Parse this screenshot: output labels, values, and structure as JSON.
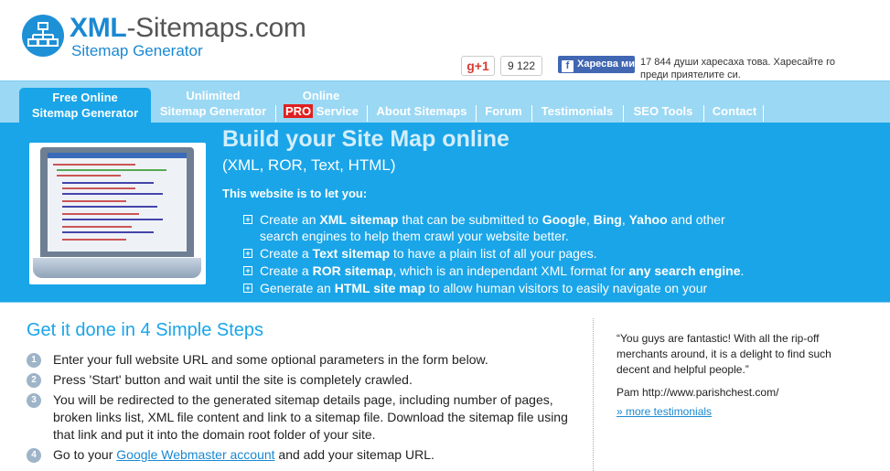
{
  "header": {
    "logo_xml": "XML",
    "logo_rest": "-Sitemaps.com",
    "logo_sub": "Sitemap Generator",
    "gplus_label": "g+1",
    "gplus_count": "9 122",
    "fb_label": "Харесва ми",
    "fb_text": "17 844 души харесаха това. Харесайте го преди приятелите си."
  },
  "nav": {
    "active_line1": "Free Online",
    "active_line2": "Sitemap Generator",
    "unlimited_line1": "Unlimited",
    "unlimited_line2": "Sitemap Generator",
    "online_line1": "Online",
    "pro": "PRO",
    "service": " Service",
    "about": "About Sitemaps",
    "forum": "Forum",
    "testimonials": "Testimonials",
    "seo": "SEO Tools",
    "contact": "Contact"
  },
  "hero": {
    "title": "Build your Site Map online",
    "subtitle": "(XML, ROR, Text, HTML)",
    "lead": "This website is to let you:",
    "items": [
      {
        "a": "Create an ",
        "b": "XML sitemap",
        "c": " that can be submitted to ",
        "d": "Google",
        "e": ", ",
        "f": "Bing",
        "g": ", ",
        "h": "Yahoo",
        "i": " and other search engines to help them crawl your website better."
      },
      {
        "a": "Create a ",
        "b": "Text sitemap",
        "c": " to have a plain list of all your pages."
      },
      {
        "a": "Create a ",
        "b": "ROR sitemap",
        "c": ", which is an independant XML format for ",
        "d": "any search engine",
        "e": "."
      },
      {
        "a": "Generate an ",
        "b": "HTML site map",
        "c": " to allow human visitors to easily navigate on your"
      }
    ]
  },
  "steps": {
    "title": "Get it done in 4 Simple Steps",
    "items": [
      {
        "num": "1",
        "text": "Enter your full website URL and some optional parameters in the form below."
      },
      {
        "num": "2",
        "text": "Press 'Start' button and wait until the site is completely crawled."
      },
      {
        "num": "3",
        "text": "You will be redirected to the generated sitemap details page, including number of pages, broken links list, XML file content and link to a sitemap file. Download the sitemap file using that link and put it into the domain root folder of your site."
      },
      {
        "num": "4",
        "pre": "Go to your ",
        "link": "Google Webmaster account",
        "post": " and add your sitemap URL."
      }
    ]
  },
  "testimonial": {
    "quote": "“You guys are fantastic! With all the rip-off merchants around, it is a delight to find such decent and helpful people.”",
    "author": "Pam http://www.parishchest.com/",
    "more": "» more testimonials"
  },
  "colors": {
    "accent": "#1aa5e8",
    "nav_bg": "#9bd8f4",
    "pro_badge": "#e0201f",
    "facebook": "#4267b2"
  }
}
